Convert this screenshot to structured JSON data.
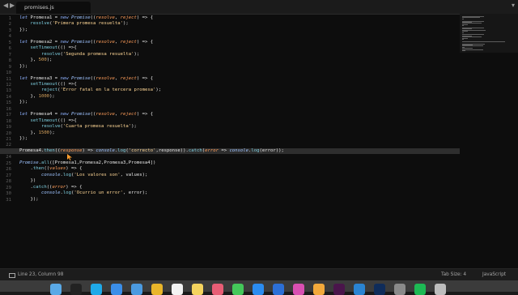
{
  "tabbar": {
    "back_icon": "chevron-left-icon",
    "forward_icon": "chevron-right-icon",
    "tab_label": "promises.js",
    "menu_icon": "chevron-down-icon"
  },
  "editor": {
    "current_line": 23,
    "lines": [
      {
        "n": "1",
        "segs": [
          [
            "kw",
            "let "
          ],
          [
            "op",
            "Promesa1 = "
          ],
          [
            "kw",
            "new "
          ],
          [
            "cls",
            "Promise"
          ],
          [
            "op",
            "(("
          ],
          [
            "param",
            "resolve"
          ],
          [
            "op",
            ", "
          ],
          [
            "param",
            "reject"
          ],
          [
            "op",
            ") => {"
          ]
        ]
      },
      {
        "n": "2",
        "segs": [
          [
            "op",
            "    "
          ],
          [
            "fn",
            "resolve"
          ],
          [
            "op",
            "("
          ],
          [
            "str",
            "'Primera promesa resuelta'"
          ],
          [
            "op",
            ");"
          ]
        ]
      },
      {
        "n": "3",
        "segs": [
          [
            "op",
            "});"
          ]
        ]
      },
      {
        "n": "4",
        "segs": []
      },
      {
        "n": "5",
        "segs": [
          [
            "kw",
            "let "
          ],
          [
            "op",
            "Promesa2 = "
          ],
          [
            "kw",
            "new "
          ],
          [
            "cls",
            "Promise"
          ],
          [
            "op",
            "(("
          ],
          [
            "param",
            "resolve"
          ],
          [
            "op",
            ", "
          ],
          [
            "param",
            "reject"
          ],
          [
            "op",
            ") => {"
          ]
        ]
      },
      {
        "n": "6",
        "segs": [
          [
            "op",
            "    "
          ],
          [
            "fn",
            "setTimeout"
          ],
          [
            "op",
            "(() =>{"
          ]
        ]
      },
      {
        "n": "7",
        "segs": [
          [
            "op",
            "        "
          ],
          [
            "fn",
            "resolve"
          ],
          [
            "op",
            "("
          ],
          [
            "str",
            "'Segunda promesa resuelta'"
          ],
          [
            "op",
            ");"
          ]
        ]
      },
      {
        "n": "8",
        "segs": [
          [
            "op",
            "    }, "
          ],
          [
            "num",
            "500"
          ],
          [
            "op",
            ");"
          ]
        ]
      },
      {
        "n": "9",
        "segs": [
          [
            "op",
            "});"
          ]
        ]
      },
      {
        "n": "10",
        "segs": []
      },
      {
        "n": "11",
        "segs": [
          [
            "kw",
            "let "
          ],
          [
            "op",
            "Promesa3 = "
          ],
          [
            "kw",
            "new "
          ],
          [
            "cls",
            "Promise"
          ],
          [
            "op",
            "(("
          ],
          [
            "param",
            "resolve"
          ],
          [
            "op",
            ", "
          ],
          [
            "param",
            "reject"
          ],
          [
            "op",
            ") => {"
          ]
        ]
      },
      {
        "n": "12",
        "segs": [
          [
            "op",
            "    "
          ],
          [
            "fn",
            "setTimeout"
          ],
          [
            "op",
            "(() =>{"
          ]
        ]
      },
      {
        "n": "13",
        "segs": [
          [
            "op",
            "        "
          ],
          [
            "fn",
            "reject"
          ],
          [
            "op",
            "("
          ],
          [
            "str",
            "'Error fatal en la tercera promesa'"
          ],
          [
            "op",
            ");"
          ]
        ]
      },
      {
        "n": "14",
        "segs": [
          [
            "op",
            "    }, "
          ],
          [
            "num",
            "1000"
          ],
          [
            "op",
            ");"
          ]
        ]
      },
      {
        "n": "15",
        "segs": [
          [
            "op",
            "});"
          ]
        ]
      },
      {
        "n": "16",
        "segs": []
      },
      {
        "n": "17",
        "segs": [
          [
            "kw",
            "let "
          ],
          [
            "op",
            "Promesa4 = "
          ],
          [
            "kw",
            "new "
          ],
          [
            "cls",
            "Promise"
          ],
          [
            "op",
            "(("
          ],
          [
            "param",
            "resolve"
          ],
          [
            "op",
            ", "
          ],
          [
            "param",
            "reject"
          ],
          [
            "op",
            ") => {"
          ]
        ]
      },
      {
        "n": "18",
        "segs": [
          [
            "op",
            "    "
          ],
          [
            "fn",
            "setTimeout"
          ],
          [
            "op",
            "(() =>{"
          ]
        ]
      },
      {
        "n": "19",
        "segs": [
          [
            "op",
            "        "
          ],
          [
            "fn",
            "resolve"
          ],
          [
            "op",
            "("
          ],
          [
            "str",
            "'Cuarta promesa resuelta'"
          ],
          [
            "op",
            ");"
          ]
        ]
      },
      {
        "n": "20",
        "segs": [
          [
            "op",
            "    }, "
          ],
          [
            "num",
            "1500"
          ],
          [
            "op",
            ");"
          ]
        ]
      },
      {
        "n": "21",
        "segs": [
          [
            "op",
            "});"
          ]
        ]
      },
      {
        "n": "22",
        "segs": []
      },
      {
        "n": "23",
        "segs": [
          [
            "op",
            "Promesa4."
          ],
          [
            "fn",
            "then"
          ],
          [
            "op",
            "(("
          ],
          [
            "param",
            "response"
          ],
          [
            "op",
            ") => "
          ],
          [
            "cls",
            "console"
          ],
          [
            "op",
            "."
          ],
          [
            "fn",
            "log"
          ],
          [
            "op",
            "("
          ],
          [
            "str",
            "'correcto'"
          ],
          [
            "op",
            ",response))."
          ],
          [
            "fn",
            "catch"
          ],
          [
            "op",
            "("
          ],
          [
            "param",
            "error"
          ],
          [
            "op",
            " => "
          ],
          [
            "cls",
            "console"
          ],
          [
            "op",
            "."
          ],
          [
            "fn",
            "log"
          ],
          [
            "op",
            "(error));"
          ]
        ]
      },
      {
        "n": "24",
        "segs": []
      },
      {
        "n": "25",
        "segs": [
          [
            "cls",
            "Promise"
          ],
          [
            "op",
            "."
          ],
          [
            "fn",
            "all"
          ],
          [
            "op",
            "([Promesa1,Promesa2,Promesa3,Promesa4])"
          ]
        ]
      },
      {
        "n": "26",
        "segs": [
          [
            "op",
            "    ."
          ],
          [
            "fn",
            "then"
          ],
          [
            "op",
            "(("
          ],
          [
            "param",
            "values"
          ],
          [
            "op",
            ") => {"
          ]
        ]
      },
      {
        "n": "27",
        "segs": [
          [
            "op",
            "        "
          ],
          [
            "cls",
            "console"
          ],
          [
            "op",
            "."
          ],
          [
            "fn",
            "log"
          ],
          [
            "op",
            "("
          ],
          [
            "str",
            "'Los valores son'"
          ],
          [
            "op",
            ", values);"
          ]
        ]
      },
      {
        "n": "28",
        "segs": [
          [
            "op",
            "    })"
          ]
        ]
      },
      {
        "n": "29",
        "segs": [
          [
            "op",
            "    ."
          ],
          [
            "fn",
            "catch"
          ],
          [
            "op",
            "(("
          ],
          [
            "param",
            "error"
          ],
          [
            "op",
            ") => {"
          ]
        ]
      },
      {
        "n": "30",
        "segs": [
          [
            "op",
            "        "
          ],
          [
            "cls",
            "console"
          ],
          [
            "op",
            "."
          ],
          [
            "fn",
            "log"
          ],
          [
            "op",
            "("
          ],
          [
            "str",
            "'Ocurrio un error'"
          ],
          [
            "op",
            ", error);"
          ]
        ]
      },
      {
        "n": "31",
        "segs": [
          [
            "op",
            "    });"
          ]
        ]
      }
    ]
  },
  "statusbar": {
    "position": "Line 23, Column 98",
    "tab_size": "Tab Size: 4",
    "syntax": "JavaScript"
  },
  "dock": {
    "icons": [
      {
        "name": "finder-icon",
        "color": "#5aa9e6"
      },
      {
        "name": "terminal-icon",
        "color": "#222222"
      },
      {
        "name": "skype-icon",
        "color": "#1fa9e8"
      },
      {
        "name": "safari-icon",
        "color": "#3b8ee8"
      },
      {
        "name": "mail-icon",
        "color": "#4b9ae0"
      },
      {
        "name": "chrome-icon",
        "color": "#e9b52a"
      },
      {
        "name": "calendar-icon",
        "color": "#f3f3f3"
      },
      {
        "name": "notes-icon",
        "color": "#f4d35e"
      },
      {
        "name": "photos-icon",
        "color": "#e85d75"
      },
      {
        "name": "messages-icon",
        "color": "#44c85a"
      },
      {
        "name": "appstore-icon",
        "color": "#2b8cf0"
      },
      {
        "name": "xcode-icon",
        "color": "#2c6fd6"
      },
      {
        "name": "itunes-icon",
        "color": "#d94fb2"
      },
      {
        "name": "sketch-icon",
        "color": "#f2a93b"
      },
      {
        "name": "slack-icon",
        "color": "#4a154b"
      },
      {
        "name": "vscode-icon",
        "color": "#2a84d2"
      },
      {
        "name": "photoshop-icon",
        "color": "#0f2c5a"
      },
      {
        "name": "preferences-icon",
        "color": "#8a8a8a"
      },
      {
        "name": "spotify-icon",
        "color": "#1db954"
      },
      {
        "name": "trash-icon",
        "color": "#bdbdbd"
      }
    ]
  }
}
